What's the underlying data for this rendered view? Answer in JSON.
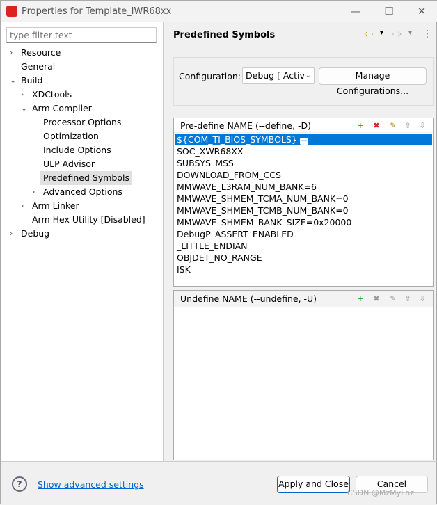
{
  "window": {
    "title": "Properties for Template_IWR68xx",
    "minimize": "—",
    "maximize": "☐",
    "close": "✕"
  },
  "filter": {
    "placeholder": "type filter text"
  },
  "tree": [
    {
      "label": "Resource",
      "level": 0,
      "chev": "›"
    },
    {
      "label": "General",
      "level": 0,
      "chev": ""
    },
    {
      "label": "Build",
      "level": 0,
      "chev": "⌄"
    },
    {
      "label": "XDCtools",
      "level": 1,
      "chev": "›"
    },
    {
      "label": "Arm Compiler",
      "level": 1,
      "chev": "⌄"
    },
    {
      "label": "Processor Options",
      "level": 2,
      "chev": ""
    },
    {
      "label": "Optimization",
      "level": 2,
      "chev": ""
    },
    {
      "label": "Include Options",
      "level": 2,
      "chev": ""
    },
    {
      "label": "ULP Advisor",
      "level": 2,
      "chev": ""
    },
    {
      "label": "Predefined Symbols",
      "level": 2,
      "chev": "",
      "selected": true
    },
    {
      "label": "Advanced Options",
      "level": 2,
      "chev": "›"
    },
    {
      "label": "Arm Linker",
      "level": 1,
      "chev": "›"
    },
    {
      "label": "Arm Hex Utility  [Disabled]",
      "level": 1,
      "chev": ""
    },
    {
      "label": "Debug",
      "level": 0,
      "chev": "›"
    }
  ],
  "page": {
    "title": "Predefined Symbols",
    "back": "⇦",
    "forward": "⇨",
    "menu": "⋮",
    "dropdown": "▾"
  },
  "config": {
    "label": "Configuration:",
    "value": "Debug  [ Activ",
    "manage": "Manage Configurations..."
  },
  "predefine": {
    "header": "Pre-define NAME (--define, -D)",
    "items": [
      "${COM_TI_BIOS_SYMBOLS}",
      "SOC_XWR68XX",
      "SUBSYS_MSS",
      "DOWNLOAD_FROM_CCS",
      "MMWAVE_L3RAM_NUM_BANK=6",
      "MMWAVE_SHMEM_TCMA_NUM_BANK=0",
      "MMWAVE_SHMEM_TCMB_NUM_BANK=0",
      "MMWAVE_SHMEM_BANK_SIZE=0x20000",
      "DebugP_ASSERT_ENABLED",
      "_LITTLE_ENDIAN",
      "OBJDET_NO_RANGE",
      "ISK"
    ],
    "more": "···"
  },
  "undefine": {
    "header": "Undefine NAME (--undefine, -U)"
  },
  "icons": {
    "add": "+",
    "delete": "✖",
    "edit": "✎",
    "up": "⇧",
    "down": "⇩"
  },
  "colors": {
    "selection": "#0078d7",
    "link": "#0066cc"
  },
  "footer": {
    "help": "?",
    "advanced": "Show advanced settings",
    "apply": "Apply and Close",
    "cancel": "Cancel",
    "watermark": "CSDN @MzMyLhz"
  }
}
